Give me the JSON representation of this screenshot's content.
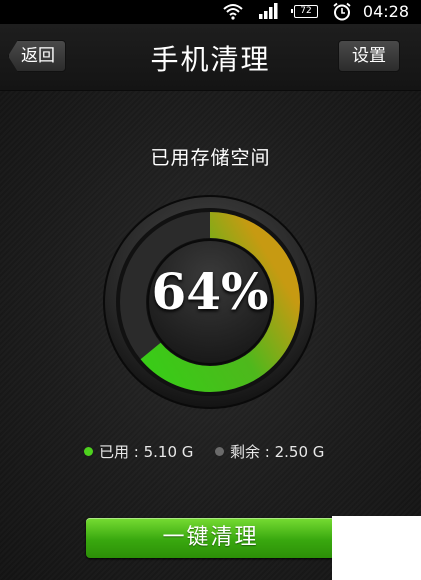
{
  "status_bar": {
    "battery_level": "72",
    "time": "04:28",
    "icons": [
      "wifi-icon",
      "signal-icon",
      "battery-icon",
      "alarm-icon"
    ]
  },
  "header": {
    "title": "手机清理",
    "back_label": "返回",
    "settings_label": "设置"
  },
  "storage": {
    "heading": "已用存储空间",
    "used_percent": 64,
    "percent_label": "64%",
    "used_label": "已用 : 5.10 G",
    "remaining_label": "剩余 : 2.50 G",
    "colors": {
      "used": "#3ec417",
      "used_end": "#c79a12",
      "remaining": "#2a2a2a",
      "track": "#303030"
    }
  },
  "actions": {
    "clean_label": "一键清理"
  }
}
